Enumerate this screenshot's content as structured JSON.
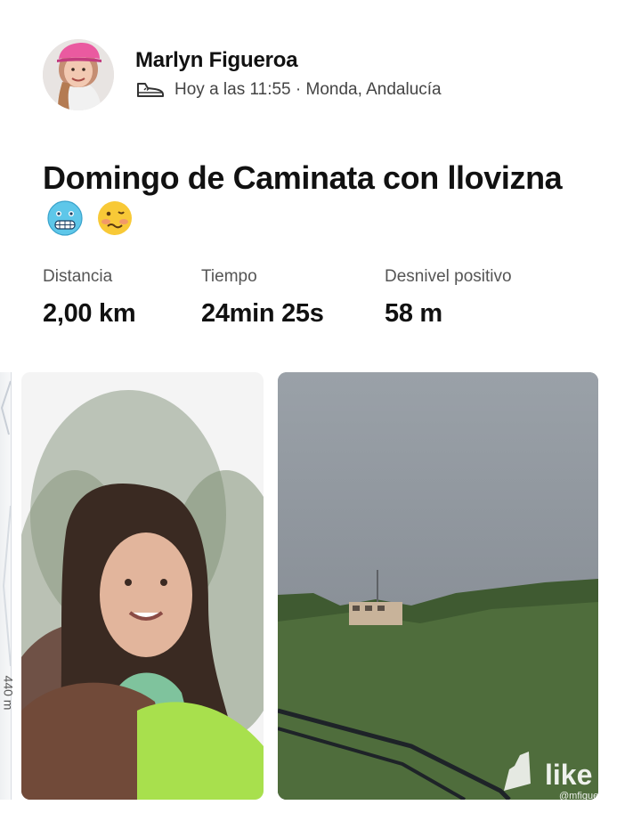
{
  "athlete": {
    "name": "Marlyn Figueroa",
    "avatar_icon": "user-avatar",
    "activity_icon": "shoe-icon",
    "meta": "Hoy a las 11:55 · Monda, Andalucía"
  },
  "activity": {
    "title": "Domingo de Caminata con llovizna",
    "emojis": [
      "freezing-face-emoji",
      "woozy-face-emoji"
    ]
  },
  "stats": [
    {
      "label": "Distancia",
      "value": "2,00 km"
    },
    {
      "label": "Tiempo",
      "value": "24min 25s"
    },
    {
      "label": "Desnivel positivo",
      "value": "58 m"
    }
  ],
  "map": {
    "scale_label": "440 m"
  },
  "photos": [
    {
      "name": "selfie-photo",
      "description_icon": "photo"
    },
    {
      "name": "landscape-photo",
      "description_icon": "photo"
    }
  ],
  "watermark": {
    "text": "like",
    "handle": "@mfigue"
  },
  "colors": {
    "text": "#111111",
    "muted": "#555555",
    "background": "#ffffff"
  }
}
